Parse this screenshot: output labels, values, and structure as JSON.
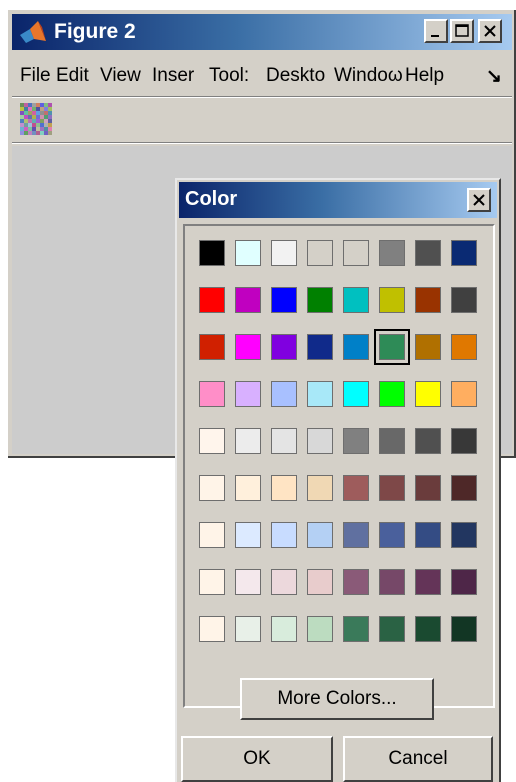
{
  "figure": {
    "title": "Figure 2",
    "menus": [
      "File",
      "Edit",
      "View",
      "Inser",
      "Tool:",
      "Deskto",
      "Windoω",
      "Help"
    ],
    "menu_overflow_glyph": "↘"
  },
  "dialog": {
    "title": "Color",
    "close_glyph": "✕",
    "more_colors_label": "More Colors...",
    "ok_label": "OK",
    "cancel_label": "Cancel",
    "selected_swatch": "#2e8b57",
    "swatches": [
      [
        "#000000",
        "#e0ffff",
        "#f2f2f2",
        "#d4d0c8",
        "#d4d0c8",
        "#808080",
        "#505050",
        "#0a2a73"
      ],
      [
        "#ff0000",
        "#c000c0",
        "#0000ff",
        "#008000",
        "#00c0c0",
        "#c0c000",
        "#993300",
        "#404040"
      ],
      [
        "#d02000",
        "#ff00ff",
        "#8000e0",
        "#102a8a",
        "#0080c8",
        "#2e8b57",
        "#b07000",
        "#e07800"
      ],
      [
        "#ff8ec8",
        "#d8b0ff",
        "#a8c0ff",
        "#a8e8f8",
        "#00ffff",
        "#00ff00",
        "#ffff00",
        "#ffae60"
      ],
      [
        "#fff5ec",
        "#ececec",
        "#e4e4e4",
        "#d8d8d8",
        "#808080",
        "#686868",
        "#505050",
        "#383838"
      ],
      [
        "#fff4e8",
        "#fff0dc",
        "#ffe4c4",
        "#f0d8b4",
        "#9e5c5c",
        "#7e4848",
        "#6a3c3c",
        "#4e2828"
      ],
      [
        "#fff4e8",
        "#dceaff",
        "#c8dcff",
        "#b4d0f4",
        "#6070a0",
        "#4a609c",
        "#344c84",
        "#223660"
      ],
      [
        "#fff4e8",
        "#f4e8ec",
        "#ecd8dc",
        "#e8cccc",
        "#8a5a78",
        "#764868",
        "#643458",
        "#4e2648"
      ],
      [
        "#fff4e8",
        "#e8f0e8",
        "#d8ecdc",
        "#bcdcc0",
        "#3a7a5a",
        "#2a6244",
        "#1a4a30",
        "#123624"
      ]
    ]
  }
}
